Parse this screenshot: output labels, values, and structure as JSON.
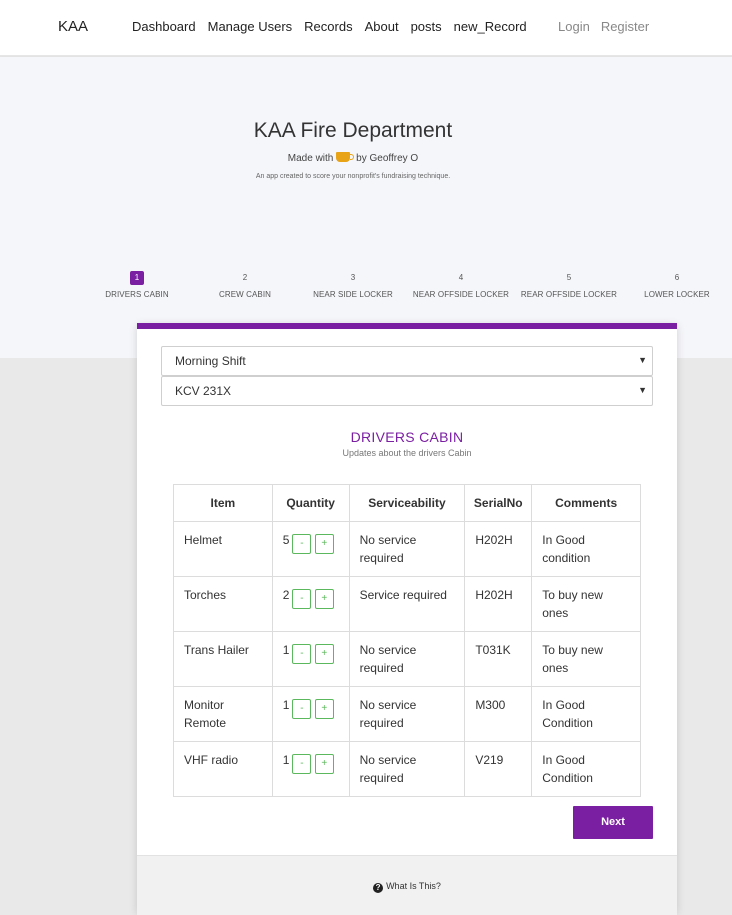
{
  "navbar": {
    "brand": "KAA",
    "links": [
      "Dashboard",
      "Manage Users",
      "Records",
      "About",
      "posts",
      "new_Record"
    ],
    "auth": [
      "Login",
      "Register"
    ]
  },
  "hero": {
    "title": "KAA Fire Department",
    "made_with": "Made with",
    "by": "by Geoffrey O",
    "tagline": "An app created to score your nonprofit's fundraising technique."
  },
  "steps": [
    {
      "num": "1",
      "label": "DRIVERS CABIN",
      "active": true
    },
    {
      "num": "2",
      "label": "CREW CABIN",
      "active": false
    },
    {
      "num": "3",
      "label": "NEAR SIDE LOCKER",
      "active": false
    },
    {
      "num": "4",
      "label": "NEAR OFFSIDE LOCKER",
      "active": false
    },
    {
      "num": "5",
      "label": "REAR OFFSIDE LOCKER",
      "active": false
    },
    {
      "num": "6",
      "label": "LOWER LOCKER",
      "active": false
    }
  ],
  "form": {
    "shift": "Morning Shift",
    "vehicle": "KCV 231X"
  },
  "section": {
    "title": "DRIVERS CABIN",
    "subtitle": "Updates about the drivers Cabin"
  },
  "table": {
    "headers": [
      "Item",
      "Quantity",
      "Serviceability",
      "SerialNo",
      "Comments"
    ],
    "rows": [
      {
        "item": "Helmet",
        "qty": "5",
        "service": "No service required",
        "serial": "H202H",
        "comment": "In Good condition"
      },
      {
        "item": "Torches",
        "qty": "2",
        "service": "Service required",
        "serial": "H202H",
        "comment": "To buy new ones"
      },
      {
        "item": "Trans Hailer",
        "qty": "1",
        "service": "No service required",
        "serial": "T031K",
        "comment": "To buy new ones"
      },
      {
        "item": "Monitor Remote",
        "qty": "1",
        "service": "No service required",
        "serial": "M300",
        "comment": "In Good Condition"
      },
      {
        "item": "VHF radio",
        "qty": "1",
        "service": "No service required",
        "serial": "V219",
        "comment": "In Good Condition"
      }
    ],
    "minus": "-",
    "plus": "+"
  },
  "next_label": "Next",
  "help_label": "What Is This?",
  "colors": {
    "accent": "#7b1fa2",
    "stepper_button": "#5cb85c"
  }
}
